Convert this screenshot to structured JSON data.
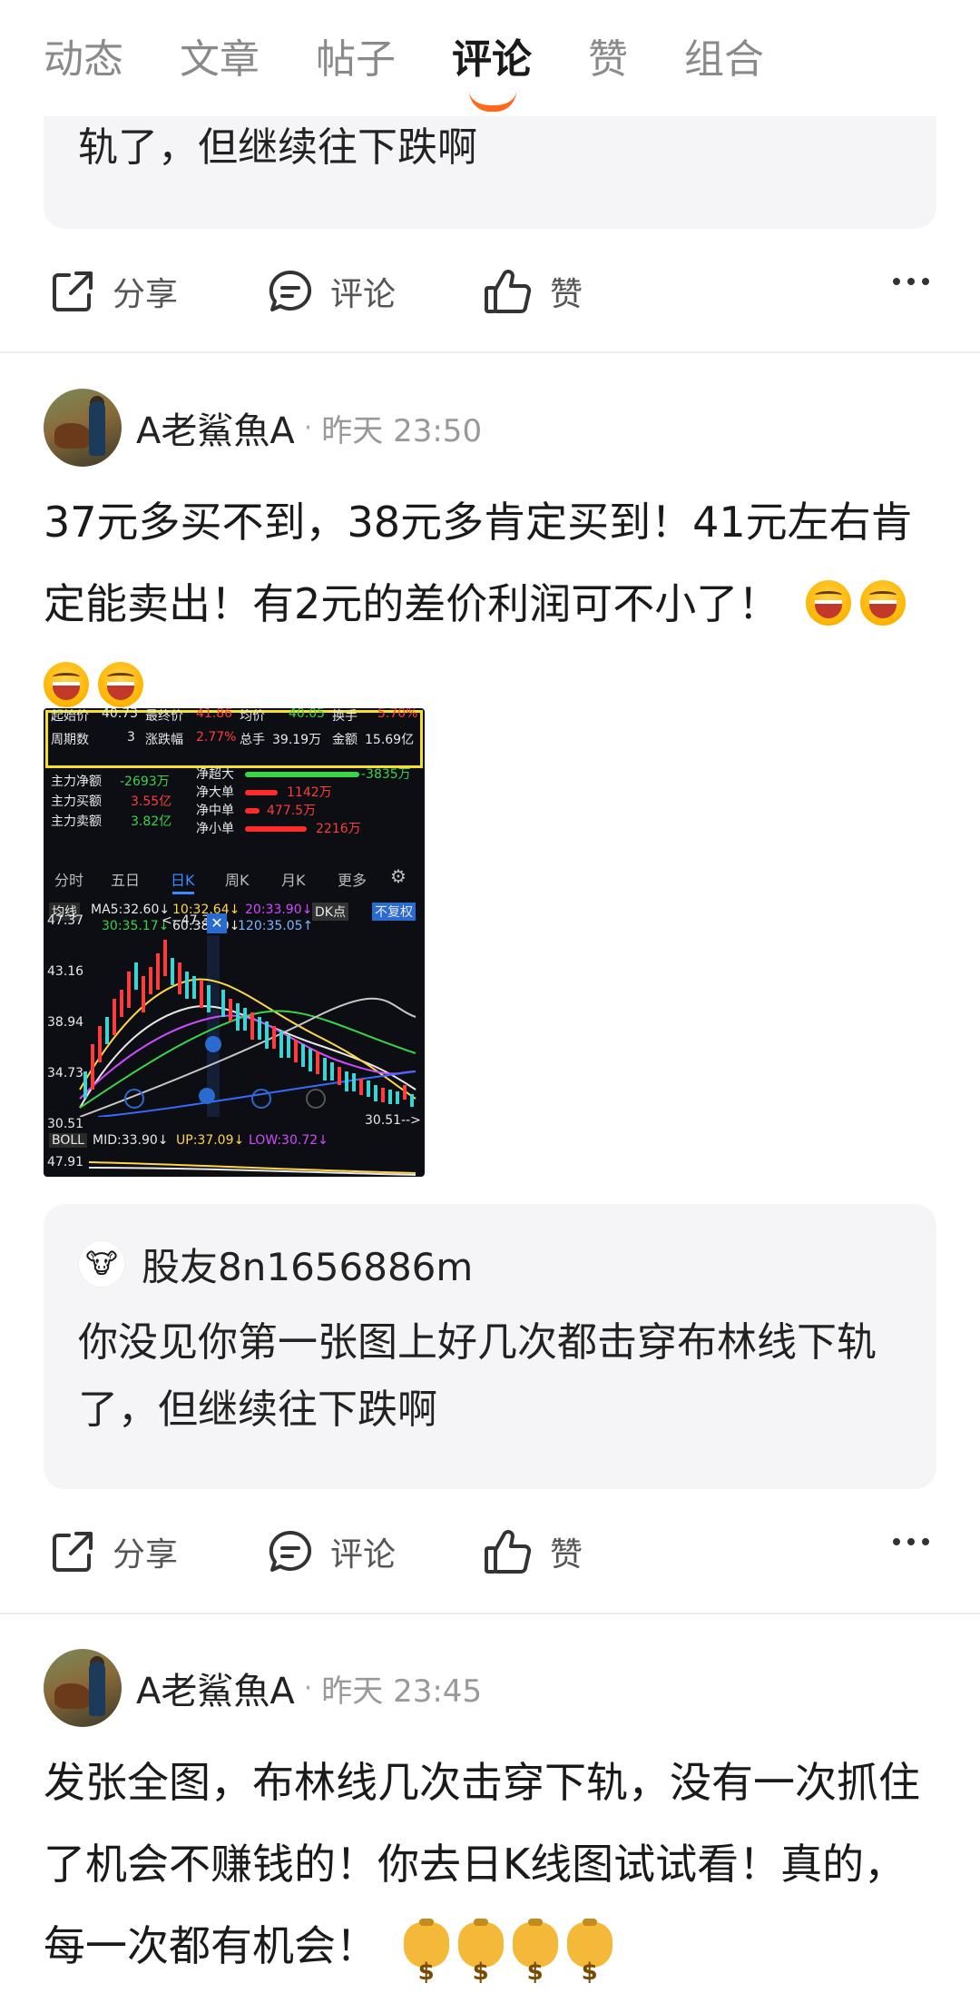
{
  "tabs": [
    {
      "label": "动态",
      "active": false
    },
    {
      "label": "文章",
      "active": false
    },
    {
      "label": "帖子",
      "active": false
    },
    {
      "label": "评论",
      "active": true
    },
    {
      "label": "赞",
      "active": false
    },
    {
      "label": "组合",
      "active": false
    }
  ],
  "top_quote": {
    "text": "轨了，但继续往下跌啊"
  },
  "actions": {
    "share": "分享",
    "comment": "评论",
    "like": "赞"
  },
  "post1": {
    "author": "A老鯊魚A",
    "separator": "·",
    "time": "昨天 23:50",
    "text": "37元多买不到，38元多肯定买到！41元左右肯定能卖出！有2元的差价利润可不小了！",
    "chart_image": {
      "row1": [
        "起始价",
        "40.73",
        "最终价",
        "41.86",
        "均价",
        "40.05",
        "换手",
        "5.70%"
      ],
      "row2": [
        "周期数",
        "3",
        "涨跌幅",
        "2.77%",
        "总手",
        "39.19万",
        "金额",
        "15.69亿"
      ],
      "flow": [
        {
          "label": "主力净额",
          "value": "-2693万"
        },
        {
          "label": "主力买额",
          "value": "3.55亿"
        },
        {
          "label": "主力卖额",
          "value": "3.82亿"
        }
      ],
      "net": [
        {
          "label": "净超大",
          "value": "-3835万"
        },
        {
          "label": "净大单",
          "value": "1142万"
        },
        {
          "label": "净中单",
          "value": "477.5万"
        },
        {
          "label": "净小单",
          "value": "2216万"
        }
      ],
      "period_tabs": [
        "分时",
        "五日",
        "日K",
        "周K",
        "月K",
        "更多"
      ],
      "ma": [
        "均线",
        "MA5:32.60↓",
        "10:32.64↓",
        "20:33.90↓",
        "DK点",
        "不复权",
        "30:35.17↓",
        "60:38.49↓",
        "120:35.05↑"
      ],
      "price_labels": [
        "47.37",
        "43.16",
        "38.94",
        "34.73",
        "30.51"
      ],
      "marker_high": "<--47.37",
      "marker_low": "30.51-->",
      "boll": [
        "BOLL",
        "MID:33.90↓",
        "UP:37.09↓",
        "LOW:30.72↓"
      ],
      "bottom_label": "47.91"
    }
  },
  "quote2": {
    "user": "股友8n1656886m",
    "text": "你没见你第一张图上好几次都击穿布林线下轨了，但继续往下跌啊"
  },
  "post2": {
    "author": "A老鯊魚A",
    "separator": "·",
    "time": "昨天 23:45",
    "text": "发张全图，布林线几次击穿下轨，没有一次抓住了机会不赚钱的！你去日K线图试试看！真的，每一次都有机会！"
  }
}
